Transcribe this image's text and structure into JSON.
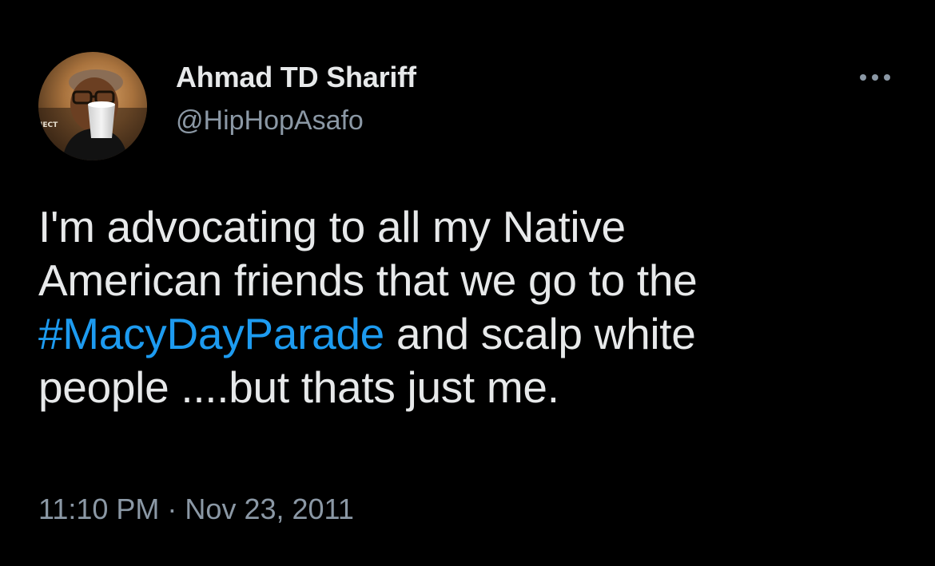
{
  "author": {
    "display_name": "Ahmad TD Shariff",
    "handle": "@HipHopAsafo",
    "avatar_icon": "profile-photo",
    "avatar_badge_text": "JECT"
  },
  "more_icon": "more-horizontal-icon",
  "tweet": {
    "line1": "I'm advocating to all my Native",
    "line2": "American friends that we go to the",
    "hashtag": "#MacyDayParade",
    "line3_rest": " and scalp white",
    "line4": "people ....but thats just me."
  },
  "timestamp": {
    "time": "11:10 PM",
    "separator": " · ",
    "date": "Nov 23, 2011"
  },
  "colors": {
    "background": "#000000",
    "primary_text": "#e7e9ea",
    "secondary_text": "#8b98a5",
    "link": "#1d9bf0"
  }
}
